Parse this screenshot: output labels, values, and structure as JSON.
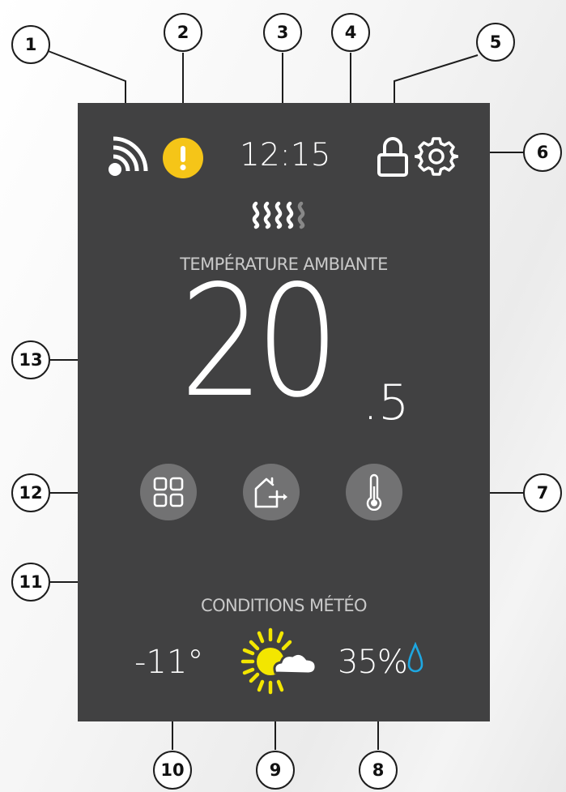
{
  "status_bar": {
    "wifi_icon": "wifi-signal-icon",
    "alert_icon": "exclamation-alert-icon",
    "time": "12:15",
    "lock_icon": "padlock-icon",
    "settings_icon": "gear-icon"
  },
  "heating_indicator": {
    "icon": "heat-waves-icon",
    "waves_total": 5,
    "waves_active": 4
  },
  "ambient": {
    "label": "TEMPÉRATURE AMBIANTE",
    "integer": "20",
    "decimal": ".5"
  },
  "buttons": {
    "menu": "grid-menu-icon",
    "away": "house-exit-icon",
    "setpoint": "thermometer-icon"
  },
  "weather": {
    "label": "CONDITIONS MÉTÉO",
    "outdoor_temp": "-11°",
    "condition_icon": "sun-cloud-icon",
    "humidity": "35%",
    "humidity_icon": "water-drop-icon"
  },
  "callouts": [
    "1",
    "2",
    "3",
    "4",
    "5",
    "6",
    "7",
    "8",
    "9",
    "10",
    "11",
    "12",
    "13"
  ],
  "colors": {
    "screen": "#414142",
    "button": "#727273",
    "alert": "#f5c518",
    "sun": "#f3e600",
    "drop": "#1ea7e1",
    "inactive_wave": "#888888"
  }
}
